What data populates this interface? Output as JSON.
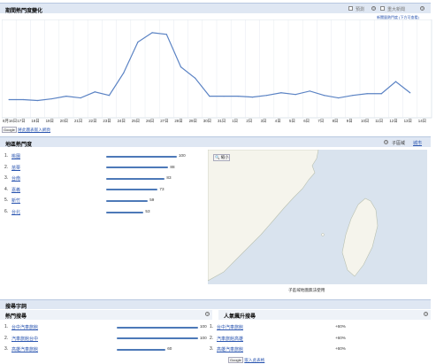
{
  "trend": {
    "title": "期間熱門度變化",
    "legend_label_1": "預測",
    "legend_label_2": "重大新聞",
    "sub_link": "新聞量熱門度 (下方可查看)",
    "ylim": [
      0,
      100
    ],
    "x_labels": [
      "8月16日",
      "17日",
      "18日",
      "19日",
      "20日",
      "21日",
      "22日",
      "23日",
      "24日",
      "25日",
      "26日",
      "27日",
      "28日",
      "29日",
      "30日",
      "31日",
      "1日",
      "2日",
      "3日",
      "4日",
      "5日",
      "6日",
      "7日",
      "8日",
      "9日",
      "10日",
      "11日",
      "12日",
      "13日",
      "14日"
    ],
    "values": [
      17,
      17,
      16,
      18,
      21,
      19,
      26,
      22,
      48,
      84,
      95,
      93,
      55,
      42,
      21,
      21,
      21,
      20,
      22,
      25,
      23,
      27,
      22,
      19,
      22,
      24,
      24,
      38,
      25
    ],
    "embed_button": "Google",
    "embed_link": "將此圖表嵌入網頁"
  },
  "regions": {
    "title": "地區熱門度",
    "subregion_label": "子區域",
    "city_link": "城市",
    "zoom_button": "縮小",
    "map_caption": "子區域地圖無法使用",
    "items": [
      {
        "rank": "1.",
        "name": "桃園",
        "value": 100
      },
      {
        "rank": "2.",
        "name": "苗栗",
        "value": 88
      },
      {
        "rank": "3.",
        "name": "台南",
        "value": 83
      },
      {
        "rank": "4.",
        "name": "嘉義",
        "value": 73
      },
      {
        "rank": "5.",
        "name": "新竹",
        "value": 59
      },
      {
        "rank": "6.",
        "name": "台北",
        "value": 53
      }
    ]
  },
  "search_terms": {
    "title": "搜尋字詞",
    "top_title": "熱門搜尋",
    "rising_title": "人氣飆升搜尋",
    "top": [
      {
        "rank": "1.",
        "name": "台中汽車旅館",
        "value": 100
      },
      {
        "rank": "2.",
        "name": "汽車旅館台中",
        "value": 100
      },
      {
        "rank": "3.",
        "name": "高雄汽車旅館",
        "value": 60
      }
    ],
    "rising": [
      {
        "rank": "1.",
        "name": "台中汽車旅館",
        "value": "+60%"
      },
      {
        "rank": "2.",
        "name": "汽車旅館高雄",
        "value": "+60%"
      },
      {
        "rank": "3.",
        "name": "高雄汽車旅館",
        "value": "+60%"
      }
    ],
    "embed_button": "Google",
    "embed_link": "嵌入此表格"
  },
  "colors": {
    "line": "#5b83c4",
    "header_bg": "#dfe7f3",
    "bar": "#4d79b8"
  }
}
